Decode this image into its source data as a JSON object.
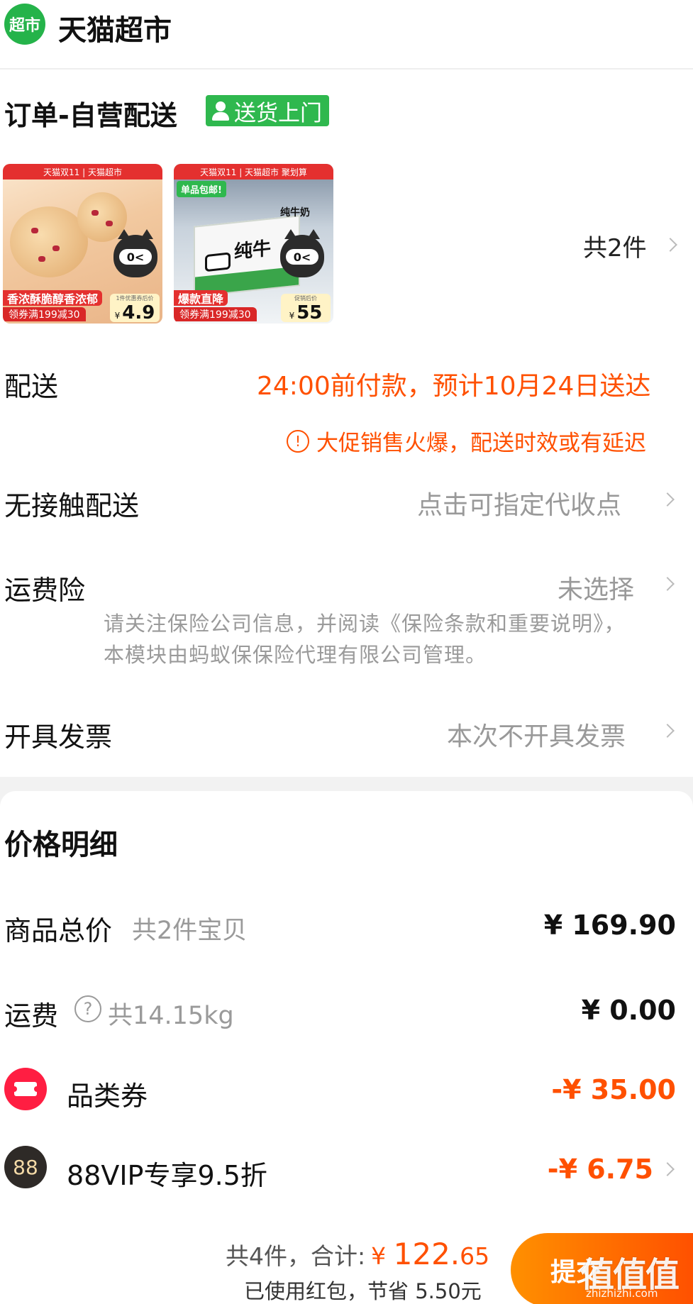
{
  "store": {
    "badge": "超市",
    "name": "天猫超市"
  },
  "order": {
    "title": "订单-自营配送",
    "delivery_tag": "送货上门"
  },
  "products": [
    {
      "banner": "天猫双11 | 天猫超市",
      "price_caption": "1件优惠券后价",
      "price": "4.9",
      "currency": "¥",
      "slogan": "香浓酥脆醇香浓郁",
      "sub": "领券满199减30"
    },
    {
      "banner": "天猫双11 | 天猫超市 聚划算",
      "price_caption": "促销后价",
      "price": "55",
      "currency": "¥",
      "slogan": "爆款直降",
      "sub": "领券满199减30",
      "box_label": "纯牛奶",
      "box_word": "纯牛",
      "pill": "单品包邮!"
    }
  ],
  "item_count": "共2件",
  "delivery": {
    "label": "配送",
    "value": "24:00前付款，预计10月24日送达",
    "warning": "大促销售火爆，配送时效或有延迟",
    "warning_icon": "!"
  },
  "contactless": {
    "label": "无接触配送",
    "value": "点击可指定代收点"
  },
  "insurance": {
    "label": "运费险",
    "value": "未选择",
    "note": "请关注保险公司信息，并阅读《保险条款和重要说明》，本模块由蚂蚁保保险代理有限公司管理。"
  },
  "invoice": {
    "label": "开具发票",
    "value": "本次不开具发票"
  },
  "price_detail": {
    "title": "价格明细",
    "goods_total": {
      "label": "商品总价",
      "sub": "共2件宝贝",
      "amount": "¥ 169.90"
    },
    "shipping": {
      "label": "运费",
      "sub": "共14.15kg",
      "amount": "¥ 0.00",
      "help_icon": "?"
    },
    "category_coupon": {
      "label": "品类券",
      "amount": "-¥ 35.00"
    },
    "vip": {
      "badge": "88",
      "label": "88VIP专享9.5折",
      "amount": "-¥ 6.75"
    }
  },
  "footer": {
    "count_total": "共4件，合计:",
    "currency": "¥",
    "total_int": "122.",
    "total_dec": "65",
    "saved": "已使用红包，节省 5.50元",
    "submit": "提交",
    "watermark": "值值值",
    "watermark_url": "zhizhizhi.com"
  },
  "colors": {
    "accent": "#ff5000",
    "green": "#2fb84e",
    "coupon": "#ff1e42"
  }
}
